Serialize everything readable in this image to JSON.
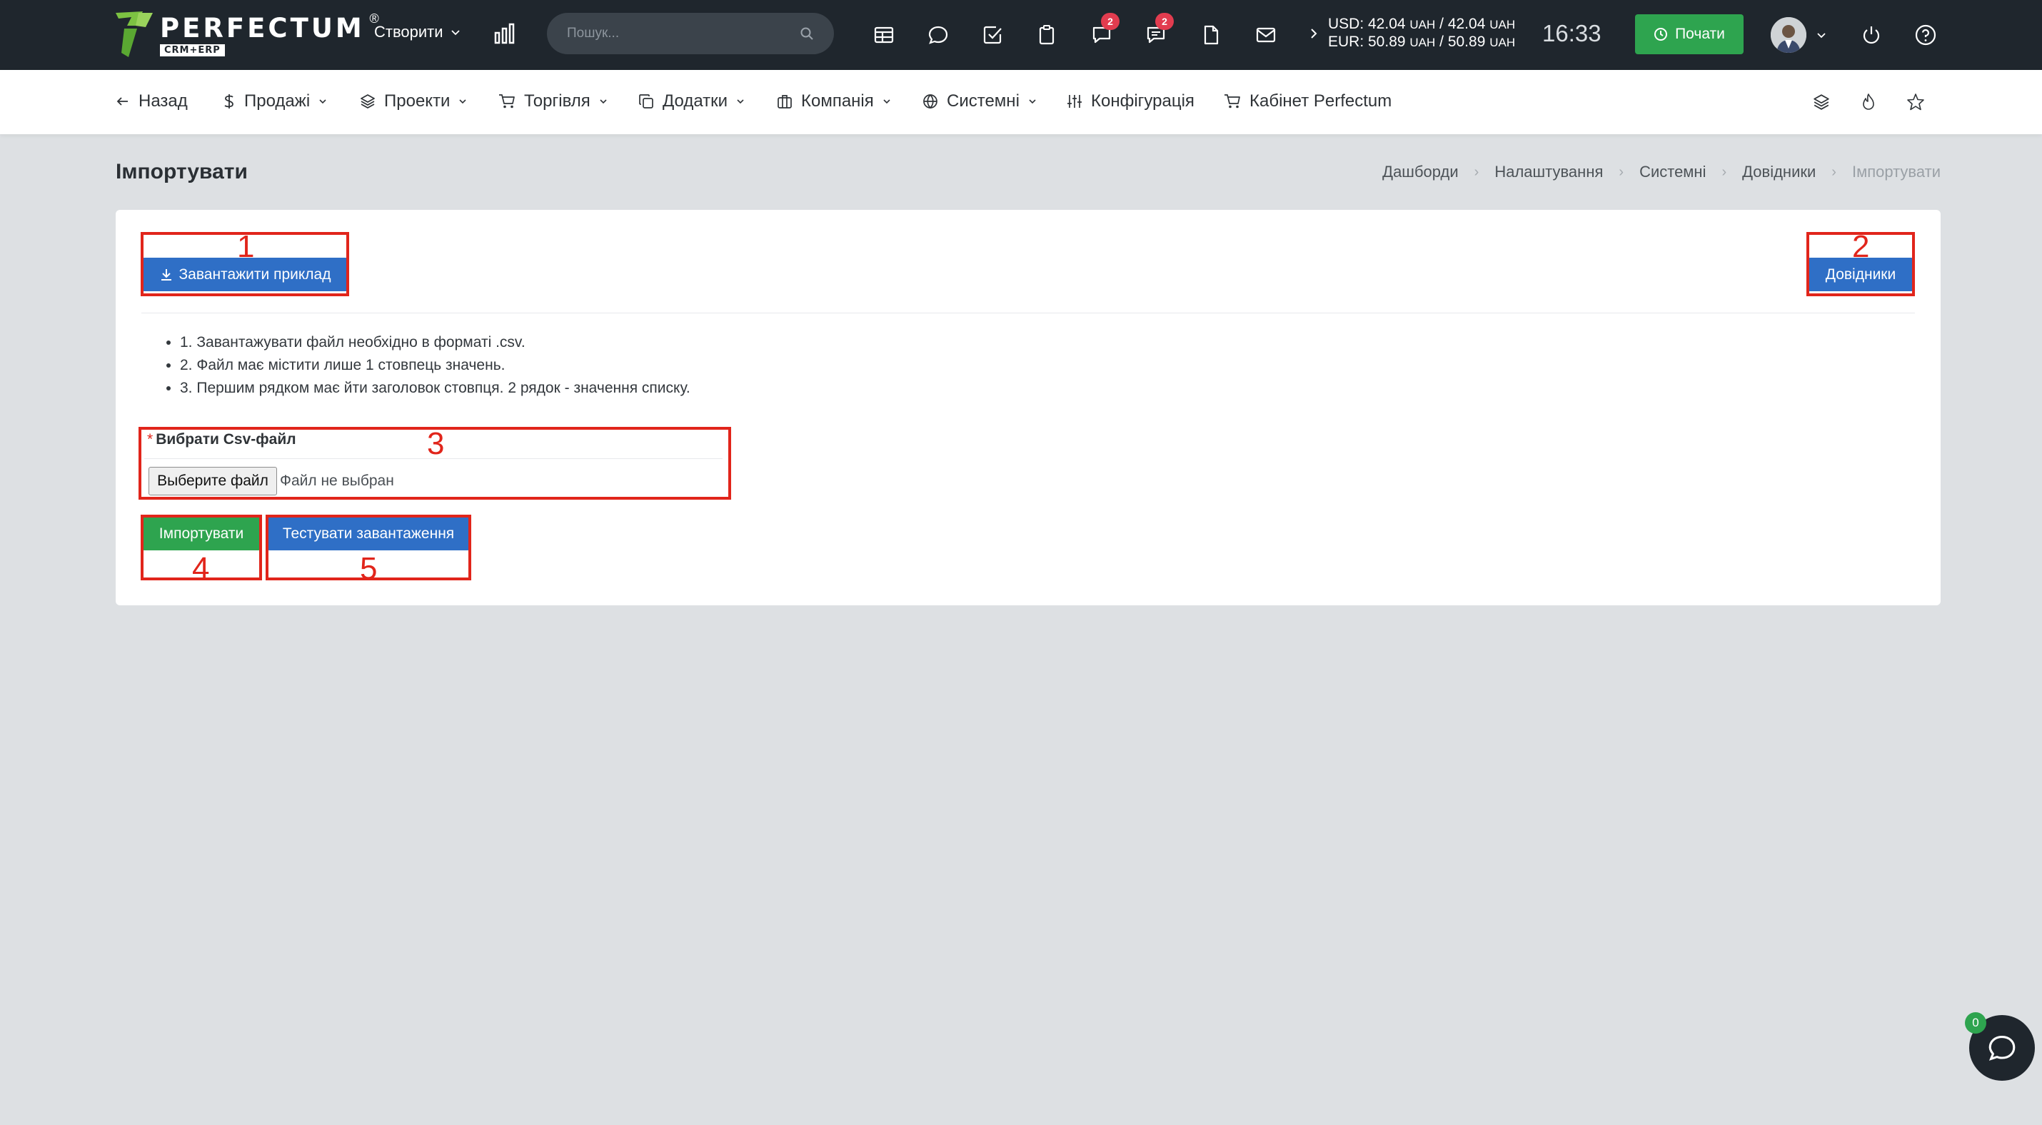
{
  "brand": {
    "name": "PERFECTUM",
    "reg": "®",
    "sub": "CRM+ERP"
  },
  "topbar": {
    "create_label": "Створити",
    "search_placeholder": "Пошук...",
    "badges": {
      "messages": "2",
      "comments": "2"
    },
    "currency": {
      "usd": "USD: 42.04",
      "usd_unit1": "UAH",
      "usd_sep": " / 42.04",
      "usd_unit2": "UAH",
      "eur": "EUR: 50.89",
      "eur_unit1": "UAH",
      "eur_sep": " / 50.89",
      "eur_unit2": "UAH"
    },
    "time": "16:33",
    "start_label": "Почати"
  },
  "nav": {
    "back": "Назад",
    "sales": "Продажі",
    "projects": "Проекти",
    "trade": "Торгівля",
    "addons": "Додатки",
    "company": "Компанія",
    "system": "Системні",
    "config": "Конфігурація",
    "cabinet": "Кабінет Perfectum"
  },
  "page": {
    "title": "Імпортувати",
    "breadcrumb": [
      "Дашборди",
      "Налаштування",
      "Системні",
      "Довідники",
      "Імпортувати"
    ]
  },
  "card": {
    "download_sample": "Завантажити приклад",
    "directories_button": "Довідники",
    "rules": [
      "1. Завантажувати файл необхідно в форматі .csv.",
      "2. Файл має містити лише 1 стовпець значень.",
      "3. Першим рядком має йти заголовок стовпця. 2 рядок - значення списку."
    ],
    "field_required_mark": "*",
    "field_label": "Вибрати Csv-файл",
    "file_button": "Выберите файл",
    "file_status": "Файл не выбран",
    "import_button": "Імпортувати",
    "test_button": "Тестувати завантаження"
  },
  "annotations": [
    "1",
    "2",
    "3",
    "4",
    "5"
  ],
  "chat": {
    "count": "0"
  },
  "colors": {
    "topbar": "#1f262d",
    "primary_blue": "#2f6fc6",
    "success_green": "#2ea44f",
    "badge_red": "#e23c4f",
    "annotation_red": "#e1251b",
    "page_bg": "#dde0e3"
  }
}
